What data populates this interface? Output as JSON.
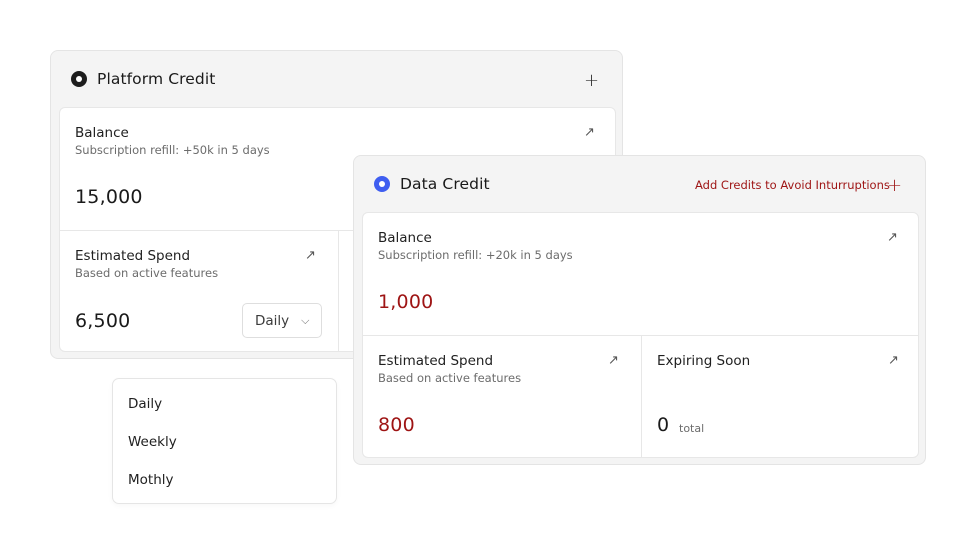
{
  "colors": {
    "accent_red": "#9e1414",
    "platform_dot": "#1d1d1d",
    "data_dot": "#3f5ef0"
  },
  "platform": {
    "title": "Platform Credit",
    "icon": "plus-icon",
    "balance": {
      "title": "Balance",
      "subtitle": "Subscription refill: +50k in 5 days",
      "value": "15,000"
    },
    "spend": {
      "title": "Estimated Spend",
      "subtitle": "Based on active features",
      "value": "6,500"
    },
    "period_select": {
      "selected": "Daily"
    }
  },
  "dropdown": {
    "options": [
      "Daily",
      "Weekly",
      "Mothly"
    ]
  },
  "data": {
    "title": "Data Credit",
    "warning": "Add Credits to Avoid Inturruptions",
    "balance": {
      "title": "Balance",
      "subtitle": "Subscription refill: +20k in 5 days",
      "value": "1,000"
    },
    "spend": {
      "title": "Estimated Spend",
      "subtitle": "Based on active features",
      "value": "800"
    },
    "expiring": {
      "title": "Expiring Soon",
      "value": "0",
      "unit": "total"
    }
  }
}
